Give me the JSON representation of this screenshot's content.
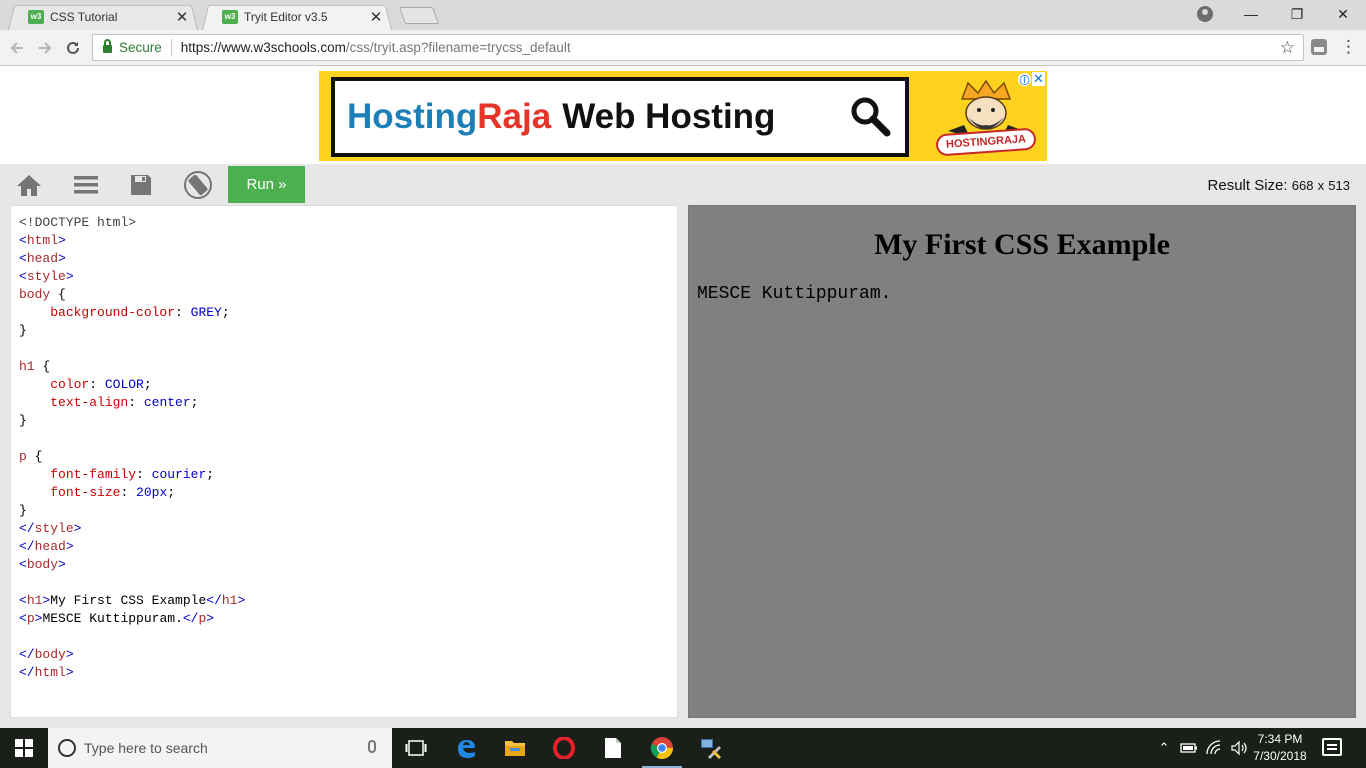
{
  "browser": {
    "tabs": [
      {
        "title": "CSS Tutorial",
        "favicon": "w3schools-favicon",
        "close": "✕"
      },
      {
        "title": "Tryit Editor v3.5",
        "favicon": "w3schools-favicon",
        "close": "✕",
        "active": true
      }
    ],
    "favicon_text": "w3",
    "window_controls": {
      "minimize": "—",
      "maximize": "❐",
      "close": "✕"
    },
    "address": {
      "secure_label": "Secure",
      "url_host": "https://www.w3schools.com",
      "url_path": "/css/tryit.asp?filename=trycss_default"
    }
  },
  "ad": {
    "brand_part1": "Hosting",
    "brand_part2": "Raja",
    "tagline": "Web Hosting",
    "logo_text": "HOSTINGRAJA",
    "info_icon": "ⓘ",
    "close_icon": "✕",
    "colors": {
      "background": "#fdd31f",
      "blue": "#1d7fb8",
      "red": "#e53429"
    }
  },
  "tryit": {
    "run_label": "Run »",
    "result_size_label": "Result Size:",
    "result_width": "668",
    "result_times": "x",
    "result_height": "513",
    "toolbar_icons": [
      "home-icon",
      "menu-icon",
      "save-icon",
      "rotate-icon"
    ],
    "accent_color": "#4caf50"
  },
  "editor": {
    "lines": [
      [
        {
          "c": "dt",
          "t": "<!DOCTYPE html>"
        }
      ],
      [
        {
          "c": "tagm",
          "t": "<"
        },
        {
          "c": "tag",
          "t": "html"
        },
        {
          "c": "tagm",
          "t": ">"
        }
      ],
      [
        {
          "c": "tagm",
          "t": "<"
        },
        {
          "c": "tag",
          "t": "head"
        },
        {
          "c": "tagm",
          "t": ">"
        }
      ],
      [
        {
          "c": "tagm",
          "t": "<"
        },
        {
          "c": "tag",
          "t": "style"
        },
        {
          "c": "tagm",
          "t": ">"
        }
      ],
      [
        {
          "c": "tag",
          "t": "body"
        },
        {
          "c": "txt",
          "t": " {"
        }
      ],
      [
        {
          "c": "txt",
          "t": "    "
        },
        {
          "c": "prop",
          "t": "background-color"
        },
        {
          "c": "txt",
          "t": ": "
        },
        {
          "c": "val",
          "t": "GREY"
        },
        {
          "c": "txt",
          "t": ";"
        }
      ],
      [
        {
          "c": "txt",
          "t": "}"
        }
      ],
      [
        {
          "c": "txt",
          "t": ""
        }
      ],
      [
        {
          "c": "tag",
          "t": "h1"
        },
        {
          "c": "txt",
          "t": " {"
        }
      ],
      [
        {
          "c": "txt",
          "t": "    "
        },
        {
          "c": "prop",
          "t": "color"
        },
        {
          "c": "txt",
          "t": ": "
        },
        {
          "c": "val",
          "t": "COLOR"
        },
        {
          "c": "txt",
          "t": ";"
        }
      ],
      [
        {
          "c": "txt",
          "t": "    "
        },
        {
          "c": "prop",
          "t": "text-align"
        },
        {
          "c": "txt",
          "t": ": "
        },
        {
          "c": "val",
          "t": "center"
        },
        {
          "c": "txt",
          "t": ";"
        }
      ],
      [
        {
          "c": "txt",
          "t": "}"
        }
      ],
      [
        {
          "c": "txt",
          "t": ""
        }
      ],
      [
        {
          "c": "tag",
          "t": "p"
        },
        {
          "c": "txt",
          "t": " {"
        }
      ],
      [
        {
          "c": "txt",
          "t": "    "
        },
        {
          "c": "prop",
          "t": "font-family"
        },
        {
          "c": "txt",
          "t": ": "
        },
        {
          "c": "val",
          "t": "courier"
        },
        {
          "c": "txt",
          "t": ";"
        }
      ],
      [
        {
          "c": "txt",
          "t": "    "
        },
        {
          "c": "prop",
          "t": "font-size"
        },
        {
          "c": "txt",
          "t": ": "
        },
        {
          "c": "val",
          "t": "20px"
        },
        {
          "c": "txt",
          "t": ";"
        }
      ],
      [
        {
          "c": "txt",
          "t": "}"
        }
      ],
      [
        {
          "c": "tagm",
          "t": "</"
        },
        {
          "c": "tag",
          "t": "style"
        },
        {
          "c": "tagm",
          "t": ">"
        }
      ],
      [
        {
          "c": "tagm",
          "t": "</"
        },
        {
          "c": "tag",
          "t": "head"
        },
        {
          "c": "tagm",
          "t": ">"
        }
      ],
      [
        {
          "c": "tagm",
          "t": "<"
        },
        {
          "c": "tag",
          "t": "body"
        },
        {
          "c": "tagm",
          "t": ">"
        }
      ],
      [
        {
          "c": "txt",
          "t": ""
        }
      ],
      [
        {
          "c": "tagm",
          "t": "<"
        },
        {
          "c": "tag",
          "t": "h1"
        },
        {
          "c": "tagm",
          "t": ">"
        },
        {
          "c": "txt",
          "t": "My First CSS Example"
        },
        {
          "c": "tagm",
          "t": "</"
        },
        {
          "c": "tag",
          "t": "h1"
        },
        {
          "c": "tagm",
          "t": ">"
        }
      ],
      [
        {
          "c": "tagm",
          "t": "<"
        },
        {
          "c": "tag",
          "t": "p"
        },
        {
          "c": "tagm",
          "t": ">"
        },
        {
          "c": "txt",
          "t": "MESCE Kuttippuram."
        },
        {
          "c": "tagm",
          "t": "</"
        },
        {
          "c": "tag",
          "t": "p"
        },
        {
          "c": "tagm",
          "t": ">"
        }
      ],
      [
        {
          "c": "txt",
          "t": ""
        }
      ],
      [
        {
          "c": "tagm",
          "t": "</"
        },
        {
          "c": "tag",
          "t": "body"
        },
        {
          "c": "tagm",
          "t": ">"
        }
      ],
      [
        {
          "c": "tagm",
          "t": "</"
        },
        {
          "c": "tag",
          "t": "html"
        },
        {
          "c": "tagm",
          "t": ">"
        }
      ]
    ]
  },
  "result": {
    "heading": "My First CSS Example",
    "paragraph": "MESCE Kuttippuram.",
    "background": "#808080"
  },
  "taskbar": {
    "search_placeholder": "Type here to search",
    "apps": [
      "task-view-icon",
      "edge-icon",
      "file-explorer-icon",
      "opera-icon",
      "notepad-icon",
      "chrome-icon",
      "tools-icon"
    ],
    "time": "7:34 PM",
    "date": "7/30/2018",
    "tray_icons": [
      "chevron-up-icon",
      "battery-icon",
      "wifi-icon",
      "volume-icon"
    ]
  }
}
